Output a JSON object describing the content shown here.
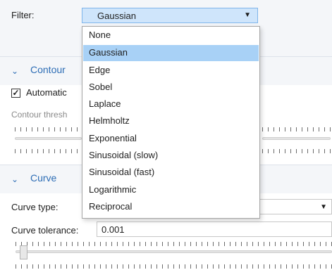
{
  "filter": {
    "label": "Filter:",
    "selected": "Gaussian",
    "options": [
      "None",
      "Gaussian",
      "Edge",
      "Sobel",
      "Laplace",
      "Helmholtz",
      "Exponential",
      "Sinusoidal (slow)",
      "Sinusoidal (fast)",
      "Logarithmic",
      "Reciprocal"
    ],
    "highlighted_index": 1
  },
  "contour": {
    "title": "Contour",
    "automatic_label": "Automatic",
    "automatic_checked": true,
    "threshold_label": "Contour thresh"
  },
  "curve": {
    "title": "Curve",
    "type_label": "Curve type:",
    "tolerance_label": "Curve tolerance:",
    "tolerance_value": "0.001"
  },
  "colors": {
    "accent": "#2d6db5",
    "selection": "#a8d1f6",
    "combo_bg": "#cfe5fb"
  }
}
